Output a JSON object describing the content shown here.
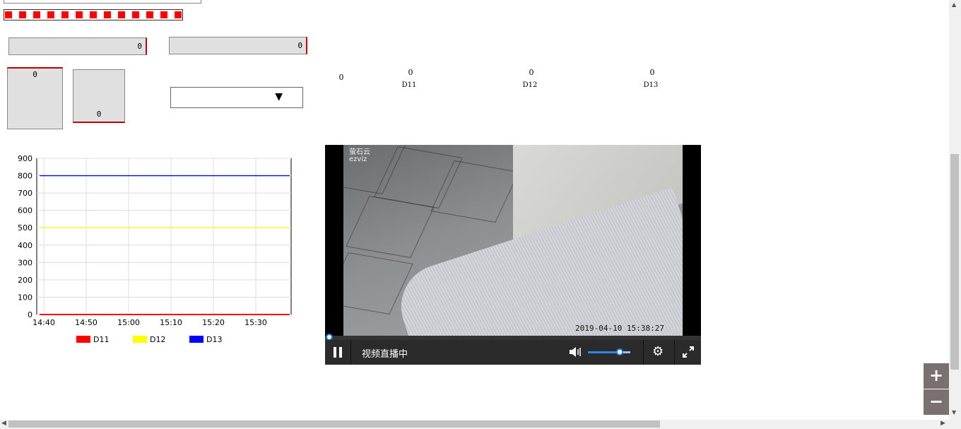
{
  "fields": {
    "field1_value": "0",
    "field2_value": "0",
    "tank1_value": "0",
    "tank2_value": "0",
    "select_value": ""
  },
  "readouts": {
    "standalone_value": "0",
    "items": [
      {
        "value": "0",
        "label": "D11"
      },
      {
        "value": "0",
        "label": "D12"
      },
      {
        "value": "0",
        "label": "D13"
      }
    ]
  },
  "chart_data": {
    "type": "line",
    "x": [
      "14:40",
      "14:50",
      "15:00",
      "15:10",
      "15:20",
      "15:30"
    ],
    "ylim": [
      0,
      900
    ],
    "yticks": [
      0,
      100,
      200,
      300,
      400,
      500,
      600,
      700,
      800,
      900
    ],
    "series": [
      {
        "name": "D11",
        "color": "#ff0000",
        "values": [
          0,
          0,
          0,
          0,
          0,
          0
        ]
      },
      {
        "name": "D12",
        "color": "#ffff00",
        "values": [
          500,
          500,
          500,
          500,
          500,
          500
        ]
      },
      {
        "name": "D13",
        "color": "#0000ff",
        "values": [
          800,
          800,
          800,
          800,
          800,
          800
        ]
      }
    ],
    "grid": true,
    "legend_position": "bottom"
  },
  "video": {
    "logo_text": "萤石云",
    "logo_sub": "ezviz",
    "timestamp": "2019-04-10 15:38:27",
    "status_text": "视频直播中",
    "volume_level": 0.75,
    "progress": 0.0
  },
  "zoom": {
    "in_label": "+",
    "out_label": "−"
  },
  "icons": [
    "pause-icon",
    "volume-icon",
    "gear-icon",
    "fullscreen-icon",
    "zoom-in-icon",
    "zoom-out-icon"
  ]
}
